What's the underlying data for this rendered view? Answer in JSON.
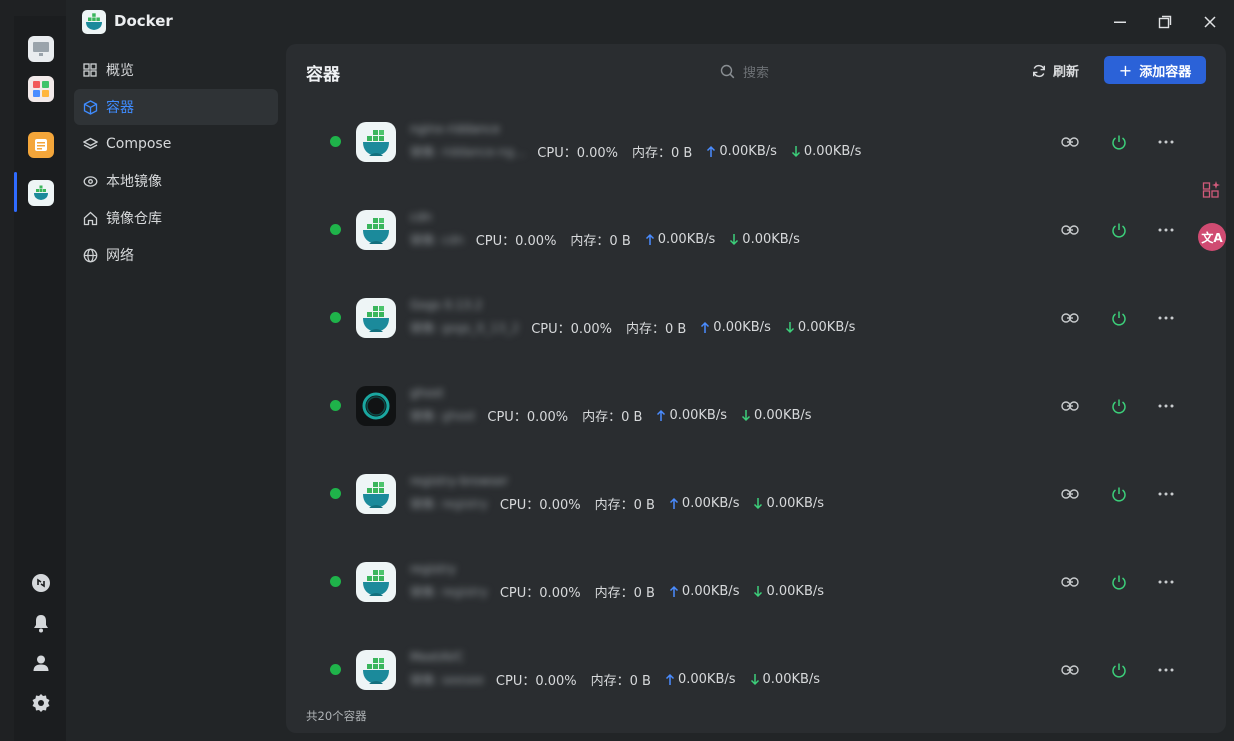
{
  "app": {
    "title": "Docker"
  },
  "sidebar": {
    "items": [
      {
        "label": "概览",
        "icon": "grid-icon"
      },
      {
        "label": "容器",
        "icon": "cube-icon",
        "active": true
      },
      {
        "label": "Compose",
        "icon": "layers-icon"
      },
      {
        "label": "本地镜像",
        "icon": "disk-icon"
      },
      {
        "label": "镜像仓库",
        "icon": "home-icon"
      },
      {
        "label": "网络",
        "icon": "globe-icon"
      }
    ]
  },
  "main": {
    "title": "容器",
    "search_placeholder": "搜索",
    "refresh_label": "刷新",
    "add_label": "添加容器",
    "plus": "+",
    "footer": "共20个容器"
  },
  "containers": [
    {
      "name": "nginx-riddance",
      "sub": "镜像: riddance-ng...",
      "cpu_label": "CPU：0.00%",
      "mem_label": "内存：0 B",
      "up": "0.00KB/s",
      "down": "0.00KB/s",
      "icon": "docker"
    },
    {
      "name": "cdn",
      "sub": "镜像: cdn",
      "cpu_label": "CPU：0.00%",
      "mem_label": "内存：0 B",
      "up": "0.00KB/s",
      "down": "0.00KB/s",
      "icon": "docker"
    },
    {
      "name": "Gogs 0.13.2",
      "sub": "镜像: gogs_0_13_2",
      "cpu_label": "CPU：0.00%",
      "mem_label": "内存：0 B",
      "up": "0.00KB/s",
      "down": "0.00KB/s",
      "icon": "docker"
    },
    {
      "name": "ghost",
      "sub": "镜像: ghost",
      "cpu_label": "CPU：0.00%",
      "mem_label": "内存：0 B",
      "up": "0.00KB/s",
      "down": "0.00KB/s",
      "icon": "ghost"
    },
    {
      "name": "registry-browser",
      "sub": "镜像: registry",
      "cpu_label": "CPU：0.00%",
      "mem_label": "内存：0 B",
      "up": "0.00KB/s",
      "down": "0.00KB/s",
      "icon": "docker"
    },
    {
      "name": "registry",
      "sub": "镜像: registry",
      "cpu_label": "CPU：0.00%",
      "mem_label": "内存：0 B",
      "up": "0.00KB/s",
      "down": "0.00KB/s",
      "icon": "docker"
    },
    {
      "name": "MeetAVC",
      "sub": "镜像: seesee",
      "cpu_label": "CPU：0.00%",
      "mem_label": "内存：0 B",
      "up": "0.00KB/s",
      "down": "0.00KB/s",
      "icon": "docker"
    }
  ],
  "colors": {
    "accent": "#2b62d8",
    "running": "#1fb34a",
    "power": "#3ccf7a",
    "active_text": "#3f8cff"
  },
  "floating": {
    "translate_label": "文A"
  }
}
